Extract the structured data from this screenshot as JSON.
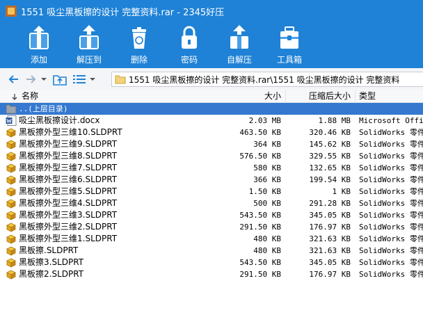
{
  "window": {
    "title": "1551 吸尘黑板擦的设计 完整资料.rar - 2345好压"
  },
  "toolbar": {
    "items": [
      {
        "label": "添加",
        "icon": "add-archive-icon"
      },
      {
        "label": "解压到",
        "icon": "extract-icon"
      },
      {
        "label": "删除",
        "icon": "trash-icon"
      },
      {
        "label": "密码",
        "icon": "lock-icon"
      },
      {
        "label": "自解压",
        "icon": "self-extract-icon"
      },
      {
        "label": "工具箱",
        "icon": "toolbox-icon"
      }
    ]
  },
  "address": {
    "path": "1551 吸尘黑板擦的设计 完整资料.rar\\1551 吸尘黑板擦的设计 完整资料"
  },
  "columns": {
    "name": "名称",
    "size": "大小",
    "packed": "压缩后大小",
    "type": "类型"
  },
  "parent_row": {
    "label": "..(上层目录)"
  },
  "files": [
    {
      "name": "吸尘黑板擦设计.docx",
      "size": "2.03 MB",
      "packed": "1.88 MB",
      "type": "Microsoft Office",
      "icon": "word-doc-icon"
    },
    {
      "name": "黑板擦外型三维10.SLDPRT",
      "size": "463.50 KB",
      "packed": "320.46 KB",
      "type": "SolidWorks 零件",
      "icon": "solidworks-part-icon"
    },
    {
      "name": "黑板擦外型三维9.SLDPRT",
      "size": "364 KB",
      "packed": "145.62 KB",
      "type": "SolidWorks 零件",
      "icon": "solidworks-part-icon"
    },
    {
      "name": "黑板擦外型三维8.SLDPRT",
      "size": "576.50 KB",
      "packed": "329.55 KB",
      "type": "SolidWorks 零件",
      "icon": "solidworks-part-icon"
    },
    {
      "name": "黑板擦外型三维7.SLDPRT",
      "size": "580 KB",
      "packed": "132.65 KB",
      "type": "SolidWorks 零件",
      "icon": "solidworks-part-icon"
    },
    {
      "name": "黑板擦外型三维6.SLDPRT",
      "size": "366 KB",
      "packed": "199.54 KB",
      "type": "SolidWorks 零件",
      "icon": "solidworks-part-icon"
    },
    {
      "name": "黑板擦外型三维5.SLDPRT",
      "size": "1.50 KB",
      "packed": "1 KB",
      "type": "SolidWorks 零件",
      "icon": "solidworks-part-icon"
    },
    {
      "name": "黑板擦外型三维4.SLDPRT",
      "size": "500 KB",
      "packed": "291.28 KB",
      "type": "SolidWorks 零件",
      "icon": "solidworks-part-icon"
    },
    {
      "name": "黑板擦外型三维3.SLDPRT",
      "size": "543.50 KB",
      "packed": "345.05 KB",
      "type": "SolidWorks 零件",
      "icon": "solidworks-part-icon"
    },
    {
      "name": "黑板擦外型三维2.SLDPRT",
      "size": "291.50 KB",
      "packed": "176.97 KB",
      "type": "SolidWorks 零件",
      "icon": "solidworks-part-icon"
    },
    {
      "name": "黑板擦外型三维1.SLDPRT",
      "size": "480 KB",
      "packed": "321.63 KB",
      "type": "SolidWorks 零件",
      "icon": "solidworks-part-icon"
    },
    {
      "name": "黑板擦.SLDPRT",
      "size": "480 KB",
      "packed": "321.63 KB",
      "type": "SolidWorks 零件",
      "icon": "solidworks-part-icon"
    },
    {
      "name": "黑板擦3.SLDPRT",
      "size": "543.50 KB",
      "packed": "345.05 KB",
      "type": "SolidWorks 零件",
      "icon": "solidworks-part-icon"
    },
    {
      "name": "黑板擦2.SLDPRT",
      "size": "291.50 KB",
      "packed": "176.97 KB",
      "type": "SolidWorks 零件",
      "icon": "solidworks-part-icon"
    }
  ],
  "colors": {
    "accent": "#1f82d6",
    "selection": "#3478d0"
  }
}
